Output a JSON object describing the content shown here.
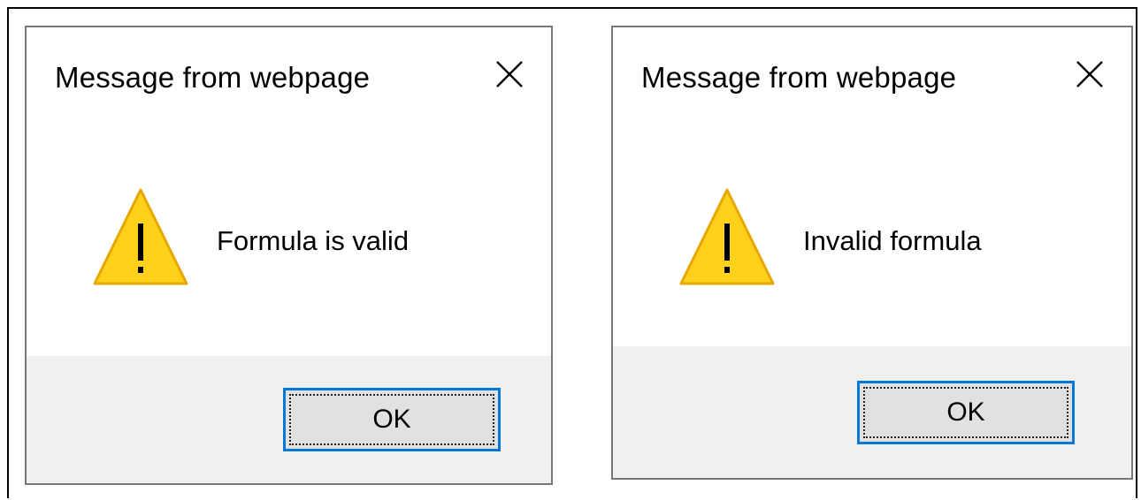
{
  "dialogs": [
    {
      "title": "Message from webpage",
      "message": "Formula is valid",
      "ok_label": "OK",
      "icon": "warning-icon",
      "close_icon": "close-icon"
    },
    {
      "title": "Message from webpage",
      "message": "Invalid formula",
      "ok_label": "OK",
      "icon": "warning-icon",
      "close_icon": "close-icon"
    }
  ],
  "colors": {
    "accent": "#0078d7",
    "footer_bg": "#f0f0f0",
    "button_bg": "#e1e1e1",
    "warning_fill": "#ffd11a",
    "warning_stroke": "#e6a700"
  }
}
